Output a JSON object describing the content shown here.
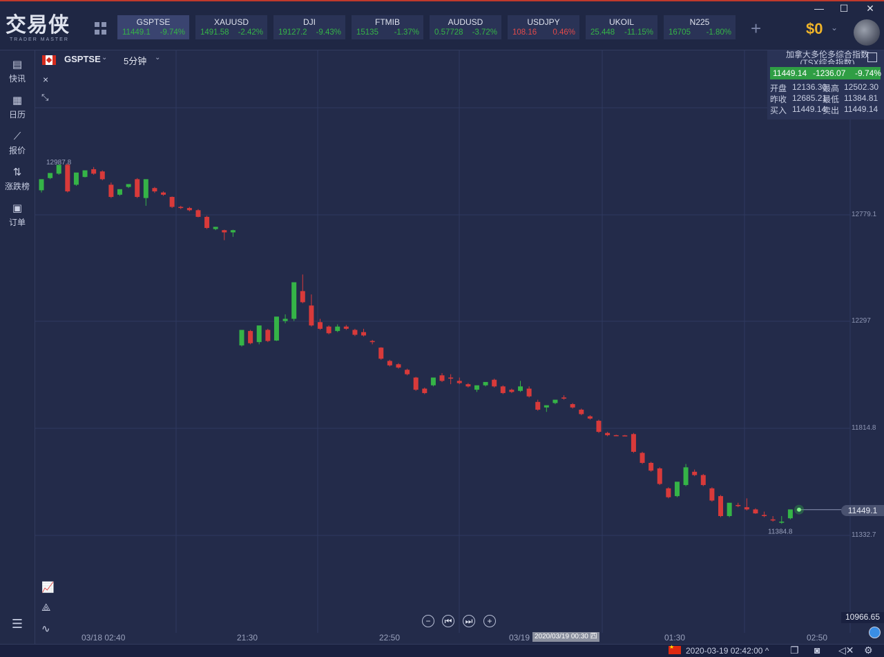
{
  "app": {
    "logo_cn": "交易侠",
    "logo_en": "TRADER MASTER",
    "balance": "$0",
    "window_controls": {
      "minimize": "—",
      "maximize": "☐",
      "close": "✕"
    }
  },
  "tickers": [
    {
      "symbol": "GSPTSE",
      "price": "11449.1",
      "change": "-9.74%",
      "direction": "up",
      "active": true
    },
    {
      "symbol": "XAUUSD",
      "price": "1491.58",
      "change": "-2.42%",
      "direction": "up",
      "active": false
    },
    {
      "symbol": "DJI",
      "price": "19127.2",
      "change": "-9.43%",
      "direction": "up",
      "active": false
    },
    {
      "symbol": "FTMIB",
      "price": "15135",
      "change": "-1.37%",
      "direction": "up",
      "active": false
    },
    {
      "symbol": "AUDUSD",
      "price": "0.57728",
      "change": "-3.72%",
      "direction": "up",
      "active": false
    },
    {
      "symbol": "USDJPY",
      "price": "108.16",
      "change": "0.46%",
      "direction": "down",
      "active": false
    },
    {
      "symbol": "UKOIL",
      "price": "25.448",
      "change": "-11.15%",
      "direction": "up",
      "active": false
    },
    {
      "symbol": "N225",
      "price": "16705",
      "change": "-1.80%",
      "direction": "up",
      "active": false
    }
  ],
  "sidebar": {
    "items": [
      {
        "label": "快讯",
        "icon": "news-icon",
        "glyph": "▤"
      },
      {
        "label": "日历",
        "icon": "calendar-icon",
        "glyph": "▦"
      },
      {
        "label": "报价",
        "icon": "quote-chart-icon",
        "glyph": "⟋"
      },
      {
        "label": "涨跌榜",
        "icon": "sort-arrows-icon",
        "glyph": "⇅"
      },
      {
        "label": "订单",
        "icon": "order-clipboard-icon",
        "glyph": "▣"
      }
    ],
    "menu_glyph": "☰"
  },
  "chart_header": {
    "symbol": "GSPTSE",
    "timeframe": "5分钟",
    "close_glyph": "×",
    "shrink_glyph": "⤡"
  },
  "info_panel": {
    "title": "加拿大多伦多综合指数 (TSX综合指数)",
    "price": "11449.14",
    "change": "-1236.07",
    "change_pct": "-9.74%",
    "rows": [
      {
        "l1": "开盘",
        "v1": "12136.30",
        "l2": "最高",
        "v2": "12502.30"
      },
      {
        "l1": "昨收",
        "v1": "12685.21",
        "l2": "最低",
        "v2": "11384.81"
      },
      {
        "l1": "买入",
        "v1": "11449.14",
        "l2": "卖出",
        "v2": "11449.14"
      }
    ]
  },
  "nav_buttons": [
    "−",
    "⏮",
    "⏭",
    "+"
  ],
  "price_corner": "10966.65",
  "cursor_date": "2020/03/19 00:30 四",
  "status": {
    "datetime": "2020-03-19 02:42:00",
    "caret": "^"
  },
  "chart_data": {
    "type": "candlestick",
    "symbol": "GSPTSE",
    "timeframe": "5分钟",
    "y_ticks": [
      12779.1,
      12297,
      11814.8,
      11332.7
    ],
    "y_tick_labels": [
      "12779.1",
      "12297",
      "11814.8",
      "11332.7"
    ],
    "x_ticks": [
      "03/18 02:40",
      "21:30",
      "22:50",
      "03/19",
      "01:30",
      "02:50"
    ],
    "high_label": "12987.8",
    "low_label": "11384.8",
    "last_price": "11449.1",
    "candles": [
      {
        "o": 12890,
        "h": 12900,
        "c": 12940,
        "l": 12880
      },
      {
        "o": 12945,
        "h": 12960,
        "c": 12968,
        "l": 12940
      },
      {
        "o": 12965,
        "h": 12990,
        "c": 13005,
        "l": 12960
      },
      {
        "o": 13005,
        "h": 13010,
        "c": 12885,
        "l": 12880
      },
      {
        "o": 12915,
        "h": 12920,
        "c": 12970,
        "l": 12910
      },
      {
        "o": 12950,
        "h": 12955,
        "c": 12980,
        "l": 12948
      },
      {
        "o": 12985,
        "h": 12995,
        "c": 12965,
        "l": 12960
      },
      {
        "o": 12975,
        "h": 12980,
        "c": 12940,
        "l": 12935
      },
      {
        "o": 12915,
        "h": 12925,
        "c": 12860,
        "l": 12855
      },
      {
        "o": 12870,
        "h": 12880,
        "c": 12895,
        "l": 12865
      },
      {
        "o": 12905,
        "h": 12912,
        "c": 12918,
        "l": 12900
      },
      {
        "o": 12940,
        "h": 12945,
        "c": 12860,
        "l": 12855
      },
      {
        "o": 12855,
        "h": 12860,
        "c": 12940,
        "l": 12820
      },
      {
        "o": 12900,
        "h": 12905,
        "c": 12885,
        "l": 12878
      },
      {
        "o": 12880,
        "h": 12885,
        "c": 12870,
        "l": 12865
      },
      {
        "o": 12860,
        "h": 12862,
        "c": 12815,
        "l": 12810
      },
      {
        "o": 12815,
        "h": 12820,
        "c": 12810,
        "l": 12805
      },
      {
        "o": 12810,
        "h": 12815,
        "c": 12800,
        "l": 12795
      },
      {
        "o": 12800,
        "h": 12805,
        "c": 12770,
        "l": 12768
      },
      {
        "o": 12770,
        "h": 12775,
        "c": 12720,
        "l": 12715
      },
      {
        "o": 12715,
        "h": 12725,
        "c": 12725,
        "l": 12710
      },
      {
        "o": 12710,
        "h": 12712,
        "c": 12700,
        "l": 12665
      },
      {
        "o": 12700,
        "h": 12712,
        "c": 12710,
        "l": 12680
      },
      {
        "o": 12190,
        "h": 12200,
        "c": 12260,
        "l": 12185
      },
      {
        "o": 12255,
        "h": 12260,
        "c": 12200,
        "l": 12195
      },
      {
        "o": 12205,
        "h": 12210,
        "c": 12280,
        "l": 12195
      },
      {
        "o": 12260,
        "h": 12265,
        "c": 12210,
        "l": 12205
      },
      {
        "o": 12212,
        "h": 12215,
        "c": 12320,
        "l": 12210
      },
      {
        "o": 12300,
        "h": 12330,
        "c": 12310,
        "l": 12290
      },
      {
        "o": 12310,
        "h": 12470,
        "c": 12475,
        "l": 12300
      },
      {
        "o": 12435,
        "h": 12510,
        "c": 12385,
        "l": 12380
      },
      {
        "o": 12370,
        "h": 12420,
        "c": 12280,
        "l": 12275
      },
      {
        "o": 12295,
        "h": 12310,
        "c": 12265,
        "l": 12260
      },
      {
        "o": 12275,
        "h": 12280,
        "c": 12245,
        "l": 12240
      },
      {
        "o": 12255,
        "h": 12285,
        "c": 12275,
        "l": 12250
      },
      {
        "o": 12275,
        "h": 12282,
        "c": 12265,
        "l": 12260
      },
      {
        "o": 12260,
        "h": 12265,
        "c": 12238,
        "l": 12232
      },
      {
        "o": 12250,
        "h": 12265,
        "c": 12235,
        "l": 12230
      },
      {
        "o": 12210,
        "h": 12215,
        "c": 12205,
        "l": 12195
      },
      {
        "o": 12180,
        "h": 12182,
        "c": 12130,
        "l": 12125
      },
      {
        "o": 12120,
        "h": 12125,
        "c": 12100,
        "l": 12095
      },
      {
        "o": 12105,
        "h": 12110,
        "c": 12090,
        "l": 12085
      },
      {
        "o": 12080,
        "h": 12085,
        "c": 12060,
        "l": 12055
      },
      {
        "o": 12045,
        "h": 12048,
        "c": 11990,
        "l": 11985
      },
      {
        "o": 11995,
        "h": 12000,
        "c": 11975,
        "l": 11970
      },
      {
        "o": 12010,
        "h": 12015,
        "c": 12045,
        "l": 12005
      },
      {
        "o": 12055,
        "h": 12065,
        "c": 12030,
        "l": 12025
      },
      {
        "o": 12045,
        "h": 12060,
        "c": 12040,
        "l": 12015
      },
      {
        "o": 12030,
        "h": 12045,
        "c": 12020,
        "l": 12015
      },
      {
        "o": 12015,
        "h": 12020,
        "c": 12005,
        "l": 12000
      },
      {
        "o": 11990,
        "h": 12005,
        "c": 12010,
        "l": 11980
      },
      {
        "o": 12010,
        "h": 12015,
        "c": 12025,
        "l": 12005
      },
      {
        "o": 12035,
        "h": 12040,
        "c": 12005,
        "l": 12000
      },
      {
        "o": 12005,
        "h": 12010,
        "c": 11975,
        "l": 11970
      },
      {
        "o": 11990,
        "h": 11995,
        "c": 11980,
        "l": 11975
      },
      {
        "o": 11985,
        "h": 12030,
        "c": 12005,
        "l": 11980
      },
      {
        "o": 11995,
        "h": 12005,
        "c": 11960,
        "l": 11955
      },
      {
        "o": 11935,
        "h": 11945,
        "c": 11900,
        "l": 11895
      },
      {
        "o": 11910,
        "h": 11915,
        "c": 11920,
        "l": 11890
      },
      {
        "o": 11930,
        "h": 11935,
        "c": 11945,
        "l": 11925
      },
      {
        "o": 11955,
        "h": 11965,
        "c": 11950,
        "l": 11945
      },
      {
        "o": 11925,
        "h": 11930,
        "c": 11910,
        "l": 11905
      },
      {
        "o": 11900,
        "h": 11905,
        "c": 11880,
        "l": 11875
      },
      {
        "o": 11870,
        "h": 11875,
        "c": 11860,
        "l": 11855
      },
      {
        "o": 11850,
        "h": 11855,
        "c": 11800,
        "l": 11795
      },
      {
        "o": 11795,
        "h": 11800,
        "c": 11785,
        "l": 11780
      },
      {
        "o": 11785,
        "h": 11787,
        "c": 11783,
        "l": 11781
      },
      {
        "o": 11784,
        "h": 11786,
        "c": 11782,
        "l": 11780
      },
      {
        "o": 11790,
        "h": 11795,
        "c": 11710,
        "l": 11705
      },
      {
        "o": 11705,
        "h": 11710,
        "c": 11660,
        "l": 11655
      },
      {
        "o": 11660,
        "h": 11665,
        "c": 11625,
        "l": 11620
      },
      {
        "o": 11635,
        "h": 11640,
        "c": 11565,
        "l": 11560
      },
      {
        "o": 11545,
        "h": 11550,
        "c": 11505,
        "l": 11500
      },
      {
        "o": 11510,
        "h": 11515,
        "c": 11575,
        "l": 11505
      },
      {
        "o": 11560,
        "h": 11655,
        "c": 11640,
        "l": 11555
      },
      {
        "o": 11620,
        "h": 11630,
        "c": 11605,
        "l": 11600
      },
      {
        "o": 11605,
        "h": 11610,
        "c": 11560,
        "l": 11555
      },
      {
        "o": 11545,
        "h": 11550,
        "c": 11490,
        "l": 11485
      },
      {
        "o": 11510,
        "h": 11515,
        "c": 11420,
        "l": 11415
      },
      {
        "o": 11420,
        "h": 11425,
        "c": 11480,
        "l": 11415
      },
      {
        "o": 11470,
        "h": 11480,
        "c": 11465,
        "l": 11460
      },
      {
        "o": 11460,
        "h": 11500,
        "c": 11450,
        "l": 11445
      },
      {
        "o": 11450,
        "h": 11455,
        "c": 11432,
        "l": 11430
      },
      {
        "o": 11425,
        "h": 11440,
        "c": 11420,
        "l": 11415
      },
      {
        "o": 11405,
        "h": 11420,
        "c": 11400,
        "l": 11395
      },
      {
        "o": 11390,
        "h": 11420,
        "c": 11395,
        "l": 11385
      },
      {
        "o": 11410,
        "h": 11415,
        "c": 11450,
        "l": 11405
      },
      {
        "o": 11450,
        "h": 11455,
        "c": 11449,
        "l": 11445
      }
    ]
  }
}
